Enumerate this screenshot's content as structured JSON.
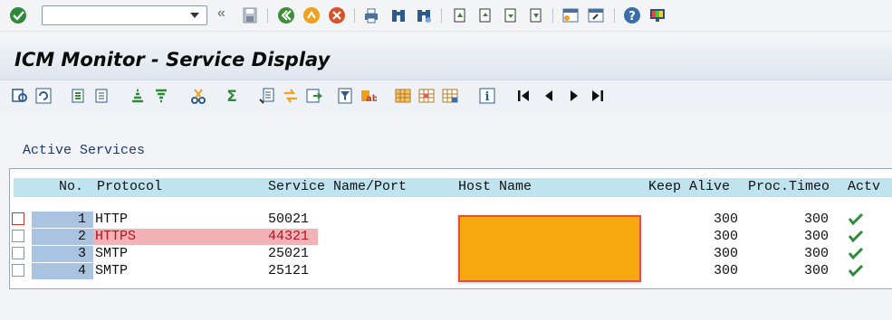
{
  "toolbar": {
    "command_field_value": "",
    "icons": [
      "enter-icon",
      "back-icon",
      "save-icon",
      "back-green-icon",
      "exit-icon",
      "cancel-icon",
      "print-icon",
      "find-icon",
      "find-next-icon",
      "first-page-icon",
      "prev-page-icon",
      "next-page-icon",
      "last-page-icon",
      "new-session-icon",
      "shortcut-icon",
      "help-icon",
      "customize-layout-icon"
    ]
  },
  "title": "ICM Monitor - Service Display",
  "section_label": "Active Services",
  "columns": {
    "no": "No.",
    "protocol": "Protocol",
    "service": "Service Name/Port",
    "host": "Host Name",
    "keepalive": "Keep Alive",
    "proctimeo": "Proc.Timeo",
    "actv": "Actv"
  },
  "rows": [
    {
      "no": "1",
      "protocol": "HTTP",
      "service": "50021",
      "keepalive": "300",
      "proctimeo": "300",
      "actv": "check"
    },
    {
      "no": "2",
      "protocol": "HTTPS",
      "service": "44321",
      "keepalive": "300",
      "proctimeo": "300",
      "actv": "check"
    },
    {
      "no": "3",
      "protocol": "SMTP",
      "service": "25021",
      "keepalive": "300",
      "proctimeo": "300",
      "actv": "check"
    },
    {
      "no": "4",
      "protocol": "SMTP",
      "service": "25121",
      "keepalive": "300",
      "proctimeo": "300",
      "actv": "check"
    }
  ],
  "highlight_color": "#f3b3b6",
  "redaction_color": "#f6a90f"
}
